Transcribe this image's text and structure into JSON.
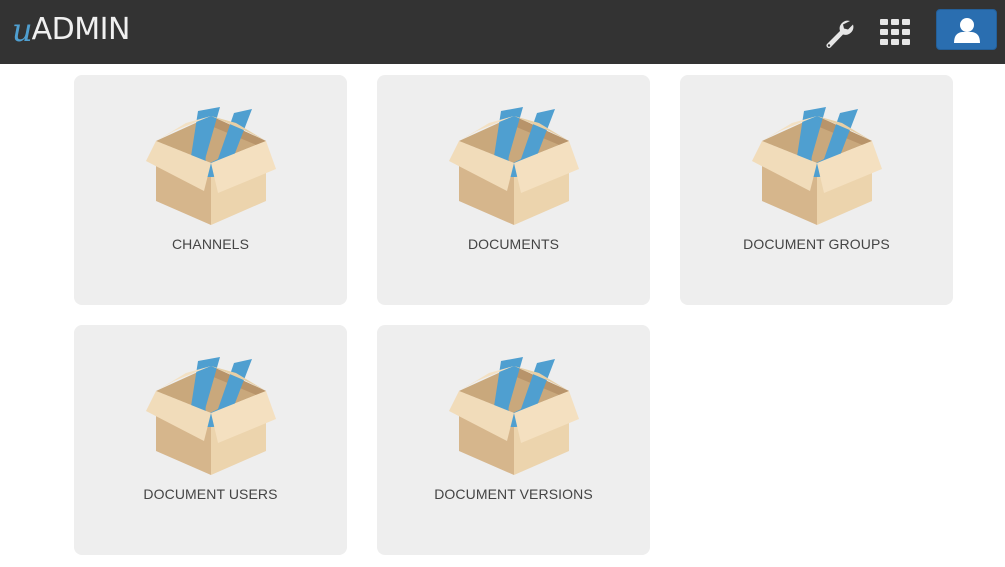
{
  "app": {
    "logo_prefix": "u",
    "logo_text": "ADMIN"
  },
  "header": {
    "icons": [
      "wrench-icon",
      "grid-icon",
      "user-icon"
    ]
  },
  "tiles": [
    {
      "label": "CHANNELS",
      "icon": "package-box-icon"
    },
    {
      "label": "DOCUMENTS",
      "icon": "package-box-icon"
    },
    {
      "label": "DOCUMENT GROUPS",
      "icon": "package-box-icon"
    },
    {
      "label": "DOCUMENT USERS",
      "icon": "package-box-icon"
    },
    {
      "label": "DOCUMENT VERSIONS",
      "icon": "package-box-icon"
    }
  ],
  "colors": {
    "header_bg": "#333333",
    "accent": "#2a6eb0",
    "logo_u": "#4f9fd0",
    "tile_bg": "#eeeeee"
  }
}
